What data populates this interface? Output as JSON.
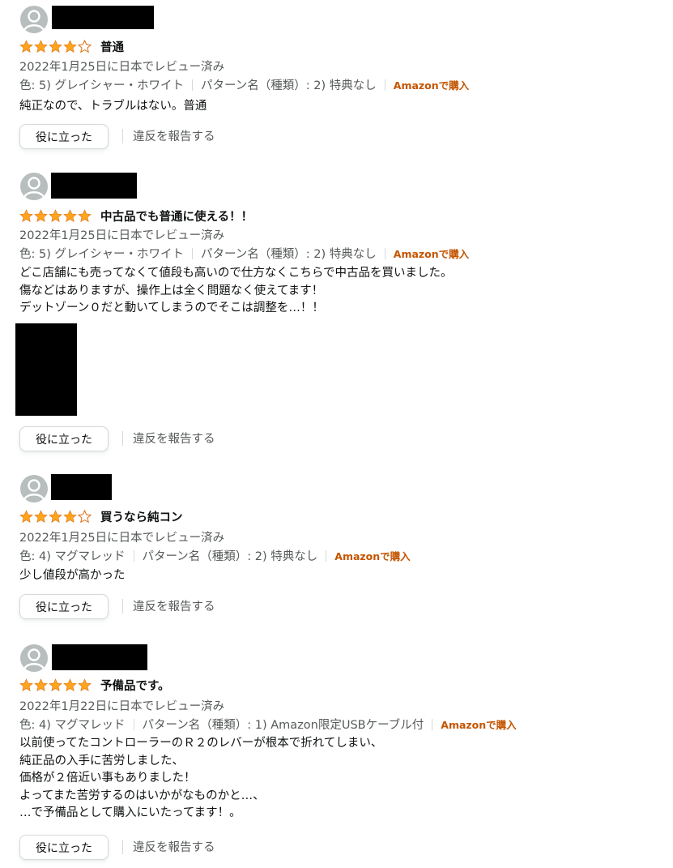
{
  "colors": {
    "star": "#FFA41C",
    "star_empty": "#DE7921",
    "verified": "#C45500",
    "meta": "#565959"
  },
  "reviews": [
    {
      "rating": 4,
      "title": "普通",
      "date": "2022年1月25日に日本でレビュー済み",
      "color": "色: 5) グレイシャー・ホワイト",
      "pattern": "パターン名（種類）: 2) 特典なし",
      "verified": "Amazonで購入",
      "body": "純正なので、トラブルはない。普通",
      "helpful": "役に立った",
      "report": "違反を報告する"
    },
    {
      "rating": 5,
      "title": "中古品でも普通に使える！！",
      "date": "2022年1月25日に日本でレビュー済み",
      "color": "色: 5) グレイシャー・ホワイト",
      "pattern": "パターン名（種類）: 2) 特典なし",
      "verified": "Amazonで購入",
      "body": "どこ店舗にも売ってなくて値段も高いので仕方なくこちらで中古品を買いました。\n傷などはありますが、操作上は全く問題なく使えてます！\nデットゾーン０だと動いてしまうのでそこは調整を…！！",
      "helpful": "役に立った",
      "report": "違反を報告する"
    },
    {
      "rating": 4,
      "title": "買うなら純コン",
      "date": "2022年1月25日に日本でレビュー済み",
      "color": "色: 4) マグマレッド",
      "pattern": "パターン名（種類）: 2) 特典なし",
      "verified": "Amazonで購入",
      "body": "少し値段が高かった",
      "helpful": "役に立った",
      "report": "違反を報告する"
    },
    {
      "rating": 5,
      "title": "予備品です。",
      "date": "2022年1月22日に日本でレビュー済み",
      "color": "色: 4) マグマレッド",
      "pattern": "パターン名（種類）: 1) Amazon限定USBケーブル付",
      "verified": "Amazonで購入",
      "body": "以前使ってたコントローラーのＲ２のレバーが根本で折れてしまい、\n純正品の入手に苦労しました、\n価格が２倍近い事もありました！\nよってまた苦労するのはいかがなものかと…、\n…で予備品として購入にいたってます！。",
      "helpful": "役に立った",
      "report": "違反を報告する"
    }
  ]
}
